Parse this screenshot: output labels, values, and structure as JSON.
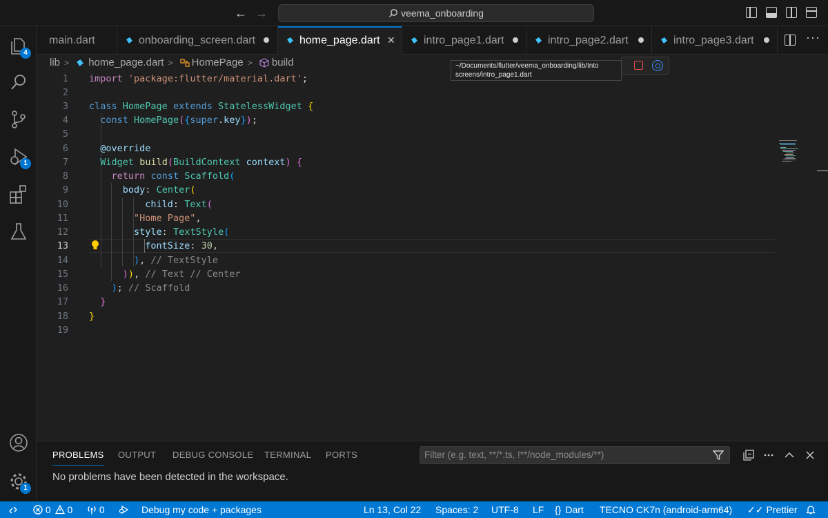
{
  "titlebar": {
    "search_text": "veema_onboarding"
  },
  "activity": {
    "explorer_badge": "4",
    "debug_badge": "1",
    "settings_badge": "1"
  },
  "tabs": [
    {
      "label": "main.dart"
    },
    {
      "label": "onboarding_screen.dart"
    },
    {
      "label": "home_page.dart",
      "active": true
    },
    {
      "label": "intro_page1.dart"
    },
    {
      "label": "intro_page2.dart"
    },
    {
      "label": "intro_page3.dart"
    }
  ],
  "breadcrumb": {
    "folder": "lib",
    "file": "home_page.dart",
    "class": "HomePage",
    "method": "build"
  },
  "tooltip": {
    "line1": "~/Documents/flutter/veema_onboarding/lib/Into",
    "line2": "screens/intro_page1.dart"
  },
  "line_numbers": [
    "1",
    "2",
    "3",
    "4",
    "5",
    "6",
    "7",
    "8",
    "9",
    "10",
    "11",
    "12",
    "13",
    "14",
    "15",
    "16",
    "17",
    "18",
    "19"
  ],
  "code": {
    "l1_kw": "import",
    "l1_str": "'package:flutter/material.dart'",
    "l1_end": ";",
    "l3_kw": "class",
    "l3_cls": "HomePage",
    "l3_kw2": "extends",
    "l3_cls2": "StatelessWidget",
    "l3_b": "{",
    "l4_kw": "const",
    "l4_cls": "HomePage",
    "l4_b1": "(",
    "l4_b2": "{",
    "l4_kw2": "super",
    "l4_dot": ".",
    "l4_var": "key",
    "l4_b3": "}",
    "l4_b4": ")",
    "l4_end": ";",
    "l6": "@override",
    "l7_cls": "Widget",
    "l7_fn": "build",
    "l7_b1": "(",
    "l7_cls2": "BuildContext",
    "l7_var": "context",
    "l7_b2": ")",
    "l7_b3": "{",
    "l8_kw": "return",
    "l8_kw2": "const",
    "l8_cls": "Scaffold",
    "l8_b": "(",
    "l9_var": "body",
    "l9_colon": ":",
    "l9_cls": "Center",
    "l9_b": "(",
    "l10_var": "child",
    "l10_colon": ":",
    "l10_cls": "Text",
    "l10_b": "(",
    "l11_str": "\"Home Page\"",
    "l11_comma": ",",
    "l12_var": "style",
    "l12_colon": ":",
    "l12_cls": "TextStyle",
    "l12_b": "(",
    "l13_var": "fontSize",
    "l13_colon": ":",
    "l13_num": "30",
    "l13_comma": ",",
    "l14_b": ")",
    "l14_comma": ",",
    "l14_cmt": "// TextStyle",
    "l15_b1": ")",
    "l15_b2": ")",
    "l15_comma": ",",
    "l15_cmt": "// Text // Center",
    "l16_b": ")",
    "l16_semi": ";",
    "l16_cmt": "// Scaffold",
    "l17_b": "}",
    "l18_b": "}"
  },
  "panel": {
    "tabs": [
      "PROBLEMS",
      "OUTPUT",
      "DEBUG CONSOLE",
      "TERMINAL",
      "PORTS"
    ],
    "filter_placeholder": "Filter (e.g. text, **/*.ts, !**/node_modules/**)",
    "message": "No problems have been detected in the workspace."
  },
  "status": {
    "errors": "0",
    "warnings": "0",
    "ports": "0",
    "debug": "Debug my code + packages",
    "position": "Ln 13, Col 22",
    "spaces": "Spaces: 2",
    "encoding": "UTF-8",
    "eol": "LF",
    "language": "Dart",
    "device": "TECNO CK7n (android-arm64)",
    "formatter": "Prettier"
  },
  "colors": {
    "accent": "#0078d4",
    "editor_bg": "#1f1f1f",
    "chrome_bg": "#181818"
  }
}
